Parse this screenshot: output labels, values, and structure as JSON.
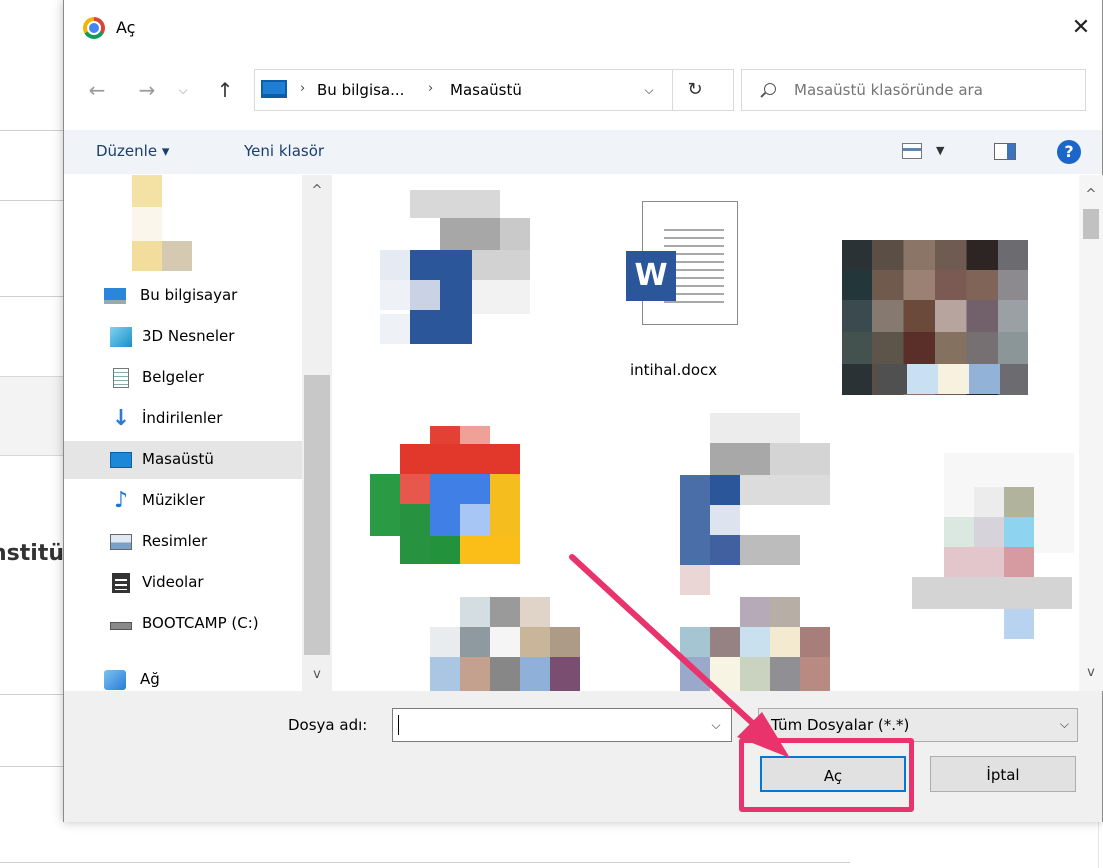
{
  "background": {
    "partial_text": "nstitü"
  },
  "dialog": {
    "title": "Aç",
    "close_symbol": "✕",
    "nav": {
      "back": "←",
      "forward": "→",
      "recent": "⌵",
      "up": "↑"
    },
    "address": {
      "breadcrumbs": [
        "Bu bilgisa...",
        "Masaüstü"
      ],
      "separator": "›",
      "dropdown": "⌵",
      "refresh": "↻"
    },
    "search": {
      "placeholder": "Masaüstü klasöründe ara"
    },
    "toolbar": {
      "organize": "Düzenle ▾",
      "new_folder": "Yeni klasör",
      "view_drop": "▼",
      "help": "?"
    },
    "nav_pane": {
      "items": [
        {
          "label": "Bu bilgisayar",
          "icon": "computer-icon",
          "root": true
        },
        {
          "label": "3D Nesneler",
          "icon": "3d-objects-icon"
        },
        {
          "label": "Belgeler",
          "icon": "documents-icon"
        },
        {
          "label": "İndirilenler",
          "icon": "downloads-icon"
        },
        {
          "label": "Masaüstü",
          "icon": "desktop-icon",
          "selected": true
        },
        {
          "label": "Müzikler",
          "icon": "music-icon"
        },
        {
          "label": "Resimler",
          "icon": "pictures-icon"
        },
        {
          "label": "Videolar",
          "icon": "videos-icon"
        },
        {
          "label": "BOOTCAMP (C:)",
          "icon": "drive-icon"
        },
        {
          "label": "Ağ",
          "icon": "network-icon",
          "root": true
        }
      ],
      "scroll_up": "^",
      "scroll_down": "v"
    },
    "files": {
      "visible_label": "intihal.docx",
      "word_letter": "W",
      "scroll_up": "^",
      "scroll_down": "v"
    },
    "bottom": {
      "file_name_label": "Dosya adı:",
      "file_name_value": "",
      "file_type": "Tüm Dosyalar (*.*)",
      "dropdown": "⌵",
      "open_button": "Aç",
      "cancel_button": "İptal"
    }
  },
  "colors": {
    "highlight": "#e8336d",
    "accent": "#0078d7",
    "selection": "#e5e5e5"
  }
}
